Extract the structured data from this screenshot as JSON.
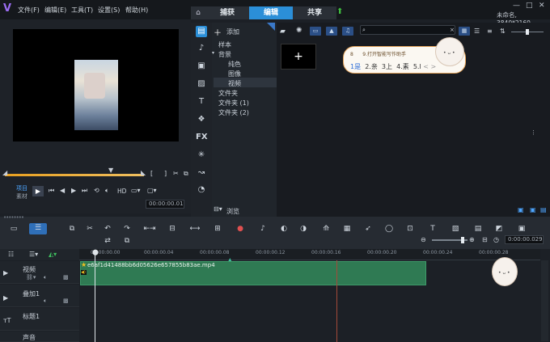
{
  "app": {
    "logo": "V",
    "project_info": "未命名, 3840*2160",
    "window_controls": [
      "—",
      "□",
      "✕"
    ]
  },
  "menu": [
    "文件(F)",
    "编辑(E)",
    "工具(T)",
    "设置(S)",
    "帮助(H)"
  ],
  "tabs": [
    "捕获",
    "编辑",
    "共享"
  ],
  "active_tab": "编辑",
  "player": {
    "mode_project": "项目",
    "mode_clip": "素材",
    "hd_label": "HD",
    "timecode": "00:00:00.01"
  },
  "library": {
    "add_label": "添加",
    "browse_label": "浏览",
    "tree": [
      "样本",
      "背景",
      "纯色",
      "图像",
      "视频",
      "文件夹",
      "文件夹 (1)",
      "文件夹 (2)"
    ],
    "selected": "视频",
    "search_placeholder": "",
    "add_media_label": "+"
  },
  "ime": {
    "hint_num": "8",
    "hint_text": "9.打开智能写作助手",
    "candidates": [
      "1是",
      "2.亲",
      "3上",
      "4.素",
      "5.l"
    ],
    "nav": [
      "<",
      ">"
    ]
  },
  "timeline": {
    "ruler_labels": [
      "00:00:00.00",
      "00:00:00.04",
      "00:00:00.08",
      "00:00:00.12",
      "00:00:00.16",
      "00:00:00.20",
      "00:00:00.24",
      "00:00:00.28"
    ],
    "tracks": [
      "视频",
      "叠加1",
      "标题1",
      "声音"
    ],
    "clip_name": "e6af1d41488bb6d05626e657855b83ae.mp4",
    "zoom_timecode": "0:00:00.029"
  }
}
